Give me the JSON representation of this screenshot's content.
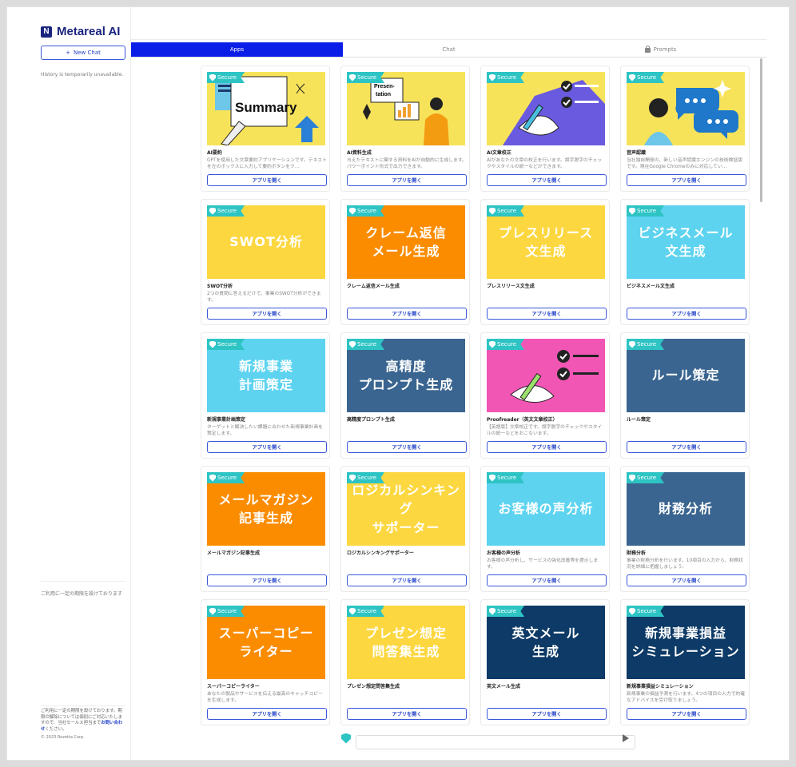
{
  "app": {
    "title": "Metareal AI",
    "logo_mark": "N"
  },
  "sidebar": {
    "new_chat_label": "New Chat",
    "history_text": "History is temporarily unavailable.",
    "notice_short": "ご利用に一定の期限を設けております",
    "notice_long_1": "ご利用に一定の期限を設けております。期限の解除については個別にご対応いたしますので、当社セールス担当まで",
    "notice_link": "お問い合わせ",
    "notice_long_2": "ください。",
    "copyright": "© 2023 Rozetta Corp."
  },
  "tabs": [
    {
      "label": "Apps",
      "active": true
    },
    {
      "label": "Chat",
      "active": false
    },
    {
      "label": "Prompts",
      "active": false
    }
  ],
  "secure_label": "Secure",
  "open_label": "アプリを開く",
  "cards": [
    {
      "title": "AI要約",
      "desc": "GPTを使用した文章要約アプリケーションです。テキストを左のボックスに入力して要約ボタンをク...",
      "thumb_text": "Summary",
      "bg": "#f7e35a",
      "fg": "#111"
    },
    {
      "title": "AI資料生成",
      "desc": "与えたテキストに関する資料をAIが自動的に生成します。パワーポイント形式で出力できます。",
      "thumb_text": "Presen-tation",
      "bg": "#f7e35a",
      "fg": "#111"
    },
    {
      "title": "AI文章校正",
      "desc": "AIがあなたの文章の校正を行います。誤字脱字のチェックやスタイルの統一などができます。",
      "thumb_text": "",
      "bg": "#f7e35a",
      "fg": "#111"
    },
    {
      "title": "音声認識",
      "desc": "当社独自開発の、新しい音声認識エンジンの技術検証版です。現在Google Chromeのみに対応してい...",
      "thumb_text": "",
      "bg": "#f7e35a",
      "fg": "#111"
    },
    {
      "title": "SWOT分析",
      "desc": "2つの質問に答えるだけで、事業のSWOT分析ができます。",
      "thumb_text": "SWOT分析",
      "bg": "#fdd740",
      "fg": "#fff"
    },
    {
      "title": "クレーム返信メール生成",
      "desc": "",
      "thumb_text": "クレーム返信\nメール生成",
      "bg": "#fb8c00",
      "fg": "#fff"
    },
    {
      "title": "プレスリリース文生成",
      "desc": "",
      "thumb_text": "プレスリリース\n文生成",
      "bg": "#fdd740",
      "fg": "#fff"
    },
    {
      "title": "ビジネスメール文生成",
      "desc": "",
      "thumb_text": "ビジネスメール\n文生成",
      "bg": "#5dd3f0",
      "fg": "#fff"
    },
    {
      "title": "新規事業計画策定",
      "desc": "ターゲットと解決したい課題に合わせた新規事業計画を策定します。",
      "thumb_text": "新規事業\n計画策定",
      "bg": "#5dd3f0",
      "fg": "#fff"
    },
    {
      "title": "高精度プロンプト生成",
      "desc": "",
      "thumb_text": "高精度\nプロンプト生成",
      "bg": "#3a6590",
      "fg": "#fff"
    },
    {
      "title": "Proofreader（英文文章校正）",
      "desc": "【英語版】文章校正です。誤字脱字のチェックやスタイルの統一などをおこないます。",
      "thumb_text": "",
      "bg": "#f256b5",
      "fg": "#fff"
    },
    {
      "title": "ルール策定",
      "desc": "",
      "thumb_text": "ルール策定",
      "bg": "#3a6590",
      "fg": "#fff"
    },
    {
      "title": "メールマガジン記事生成",
      "desc": "",
      "thumb_text": "メールマガジン\n記事生成",
      "bg": "#fb8c00",
      "fg": "#fff"
    },
    {
      "title": "ロジカルシンキングサポーター",
      "desc": "",
      "thumb_text": "ロジカルシンキング\nサポーター",
      "bg": "#fdd740",
      "fg": "#fff"
    },
    {
      "title": "お客様の声分析",
      "desc": "お客様の声分析し、サービスの強化改善等を提示します。",
      "thumb_text": "お客様の声分析",
      "bg": "#5dd3f0",
      "fg": "#fff"
    },
    {
      "title": "財務分析",
      "desc": "事業の財務分析を行います。10項目の入力から、財務状況を詳細に把握しましょう。",
      "thumb_text": "財務分析",
      "bg": "#3a6590",
      "fg": "#fff"
    },
    {
      "title": "スーパーコピーライター",
      "desc": "あなたの製品やサービスを伝える最高のキャッチコピーを生成します。",
      "thumb_text": "スーパーコピー\nライター",
      "bg": "#fb8c00",
      "fg": "#fff"
    },
    {
      "title": "プレゼン想定問答集生成",
      "desc": "",
      "thumb_text": "プレゼン想定\n問答集生成",
      "bg": "#fdd740",
      "fg": "#fff"
    },
    {
      "title": "英文メール生成",
      "desc": "",
      "thumb_text": "英文メール\n生成",
      "bg": "#0d3a66",
      "fg": "#fff"
    },
    {
      "title": "新規事業損益シミュレーション",
      "desc": "新規事業の損益予測を行います。4つの項目の入力で的確なアドバイスを受け取りましょう。",
      "thumb_text": "新規事業損益\nシミュレーション",
      "bg": "#0d3a66",
      "fg": "#fff"
    }
  ],
  "chat": {
    "placeholder": "",
    "value": ""
  }
}
